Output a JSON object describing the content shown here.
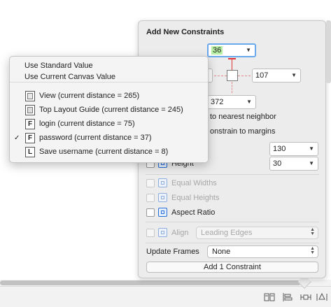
{
  "popover": {
    "title": "Add New Constraints",
    "top_value": "36",
    "left_value": "",
    "right_value": "107",
    "bottom_value": "372",
    "spacing_neighbor_label": "to nearest neighbor",
    "margins_label": "onstrain to margins",
    "width_value": "130",
    "height_label": "Height",
    "height_value": "30",
    "equal_widths_label": "Equal Widths",
    "equal_heights_label": "Equal Heights",
    "aspect_ratio_label": "Aspect Ratio",
    "align_label": "Align",
    "align_value": "Leading Edges",
    "update_frames_label": "Update Frames",
    "update_frames_value": "None",
    "add_button_label": "Add 1 Constraint"
  },
  "menu": {
    "standard": "Use Standard Value",
    "canvas": "Use Current Canvas Value",
    "items": [
      {
        "icon": "",
        "label": "View (current distance = 265)",
        "checked": false
      },
      {
        "icon": "",
        "label": "Top Layout Guide (current distance = 245)",
        "checked": false
      },
      {
        "icon": "F",
        "label": "login (current distance = 75)",
        "checked": false
      },
      {
        "icon": "F",
        "label": "password (current distance = 37)",
        "checked": true
      },
      {
        "icon": "L",
        "label": "Save username (current distance = 8)",
        "checked": false
      }
    ],
    "check_glyph": "✓"
  },
  "bottom_bar": {
    "icons": [
      "embed-in-stack-icon",
      "align-icon",
      "pin-icon",
      "resolve-issues-icon"
    ]
  }
}
